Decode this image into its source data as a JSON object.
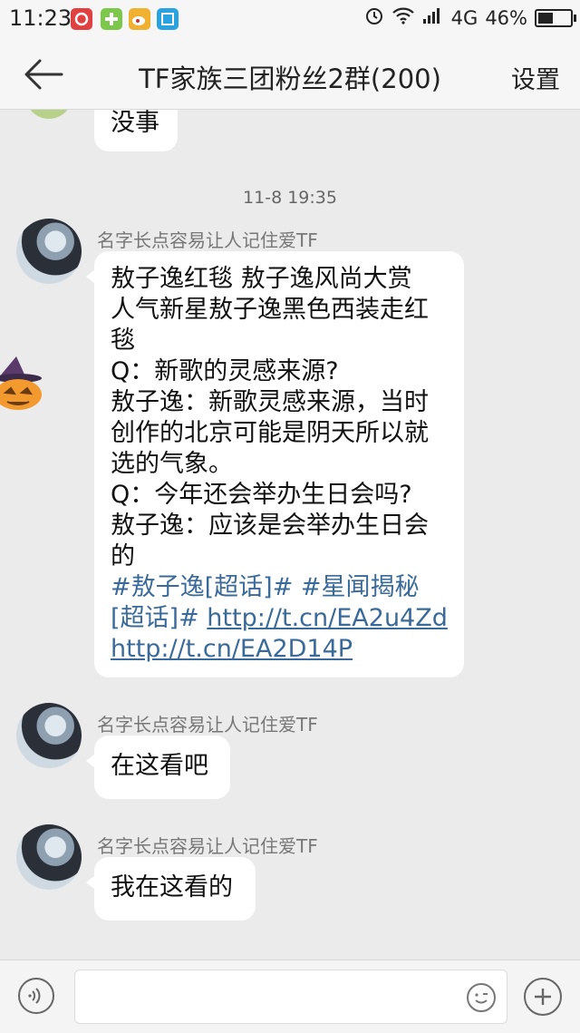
{
  "status_bar": {
    "time": "11:23",
    "network": "4G",
    "battery": "46%",
    "battery_level": 0.46,
    "app_icons": [
      {
        "name": "netease-music-icon",
        "color": "#e04040"
      },
      {
        "name": "game-icon",
        "color": "#7cc84a"
      },
      {
        "name": "weibo-icon",
        "color": "#f0b030"
      },
      {
        "name": "screenshot-icon",
        "color": "#29a3e0"
      }
    ]
  },
  "header": {
    "title": "TF家族三团粉丝2群(200)",
    "settings": "设置"
  },
  "messages": {
    "prev_text": "没事",
    "timestamp": "11-8 19:35",
    "m1": {
      "sender": "名字长点容易让人记住爱TF",
      "lines": [
        "敖子逸红毯 敖子逸风尚大赏",
        "人气新星敖子逸黑色西装走红",
        "毯",
        "Q：新歌的灵感来源?",
        "敖子逸：新歌灵感来源，当时",
        "创作的北京可能是阴天所以就",
        "选的气象。",
        "Q：今年还会举办生日会吗?",
        "敖子逸：应该是会举办生日会",
        "的"
      ],
      "tag1": "#敖子逸[超话]#",
      "tag2": "#星闻揭秘",
      "tag2b": "[超话]#",
      "url1": "http://t.cn/EA2u4Zd",
      "url2": "http://t.cn/EA2D14P"
    },
    "m2": {
      "sender": "名字长点容易让人记住爱TF",
      "text": "在这看吧"
    },
    "m3": {
      "sender": "名字长点容易让人记住爱TF",
      "text": "我在这看的"
    }
  },
  "input_bar": {
    "placeholder": ""
  }
}
